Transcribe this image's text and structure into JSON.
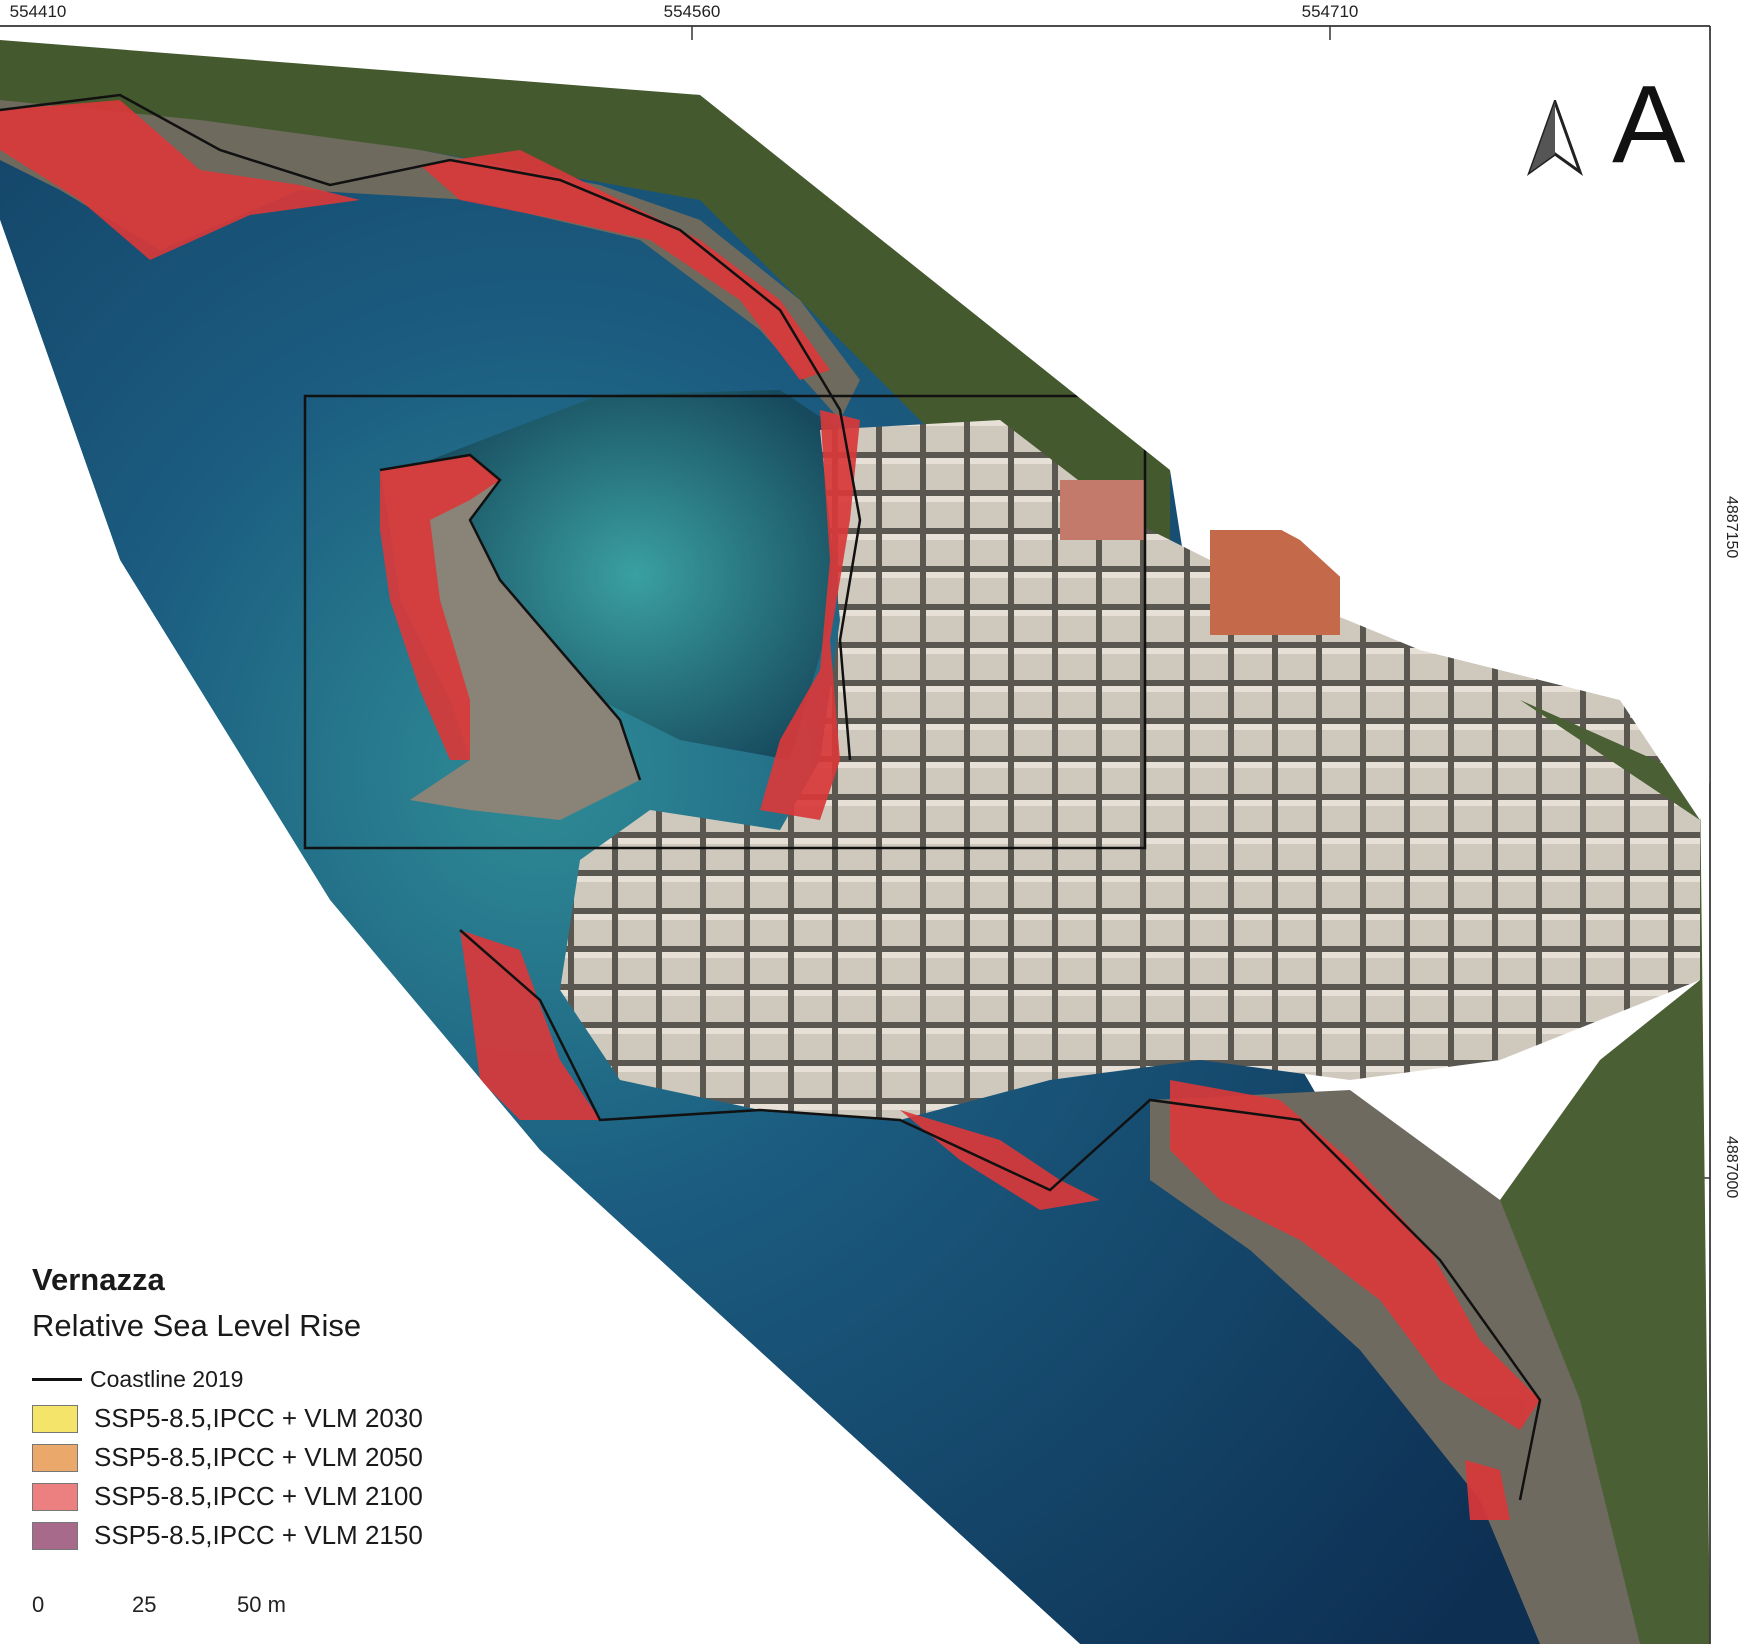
{
  "map": {
    "panel_letter": "A",
    "coords_top": [
      "554410",
      "554560",
      "554710"
    ],
    "coords_right": [
      "4887150",
      "4887000"
    ],
    "colors": {
      "sea_deep": "#0f3558",
      "sea_mid": "#1f6a8a",
      "sea_shallow": "#3a9aa0",
      "land": "#7a7a6a",
      "vegetation": "#3d5a2a",
      "roof": "#c8c0b4",
      "inundation": "#d9383a"
    }
  },
  "legend": {
    "place": "Vernazza",
    "subtitle": "Relative Sea Level Rise",
    "coastline": "Coastline 2019",
    "items": [
      {
        "label": "SSP5-8.5,IPCC + VLM 2030",
        "color": "#f5e46a"
      },
      {
        "label": "SSP5-8.5,IPCC + VLM 2050",
        "color": "#eaa86a"
      },
      {
        "label": "SSP5-8.5,IPCC + VLM 2100",
        "color": "#ec8080"
      },
      {
        "label": "SSP5-8.5,IPCC + VLM 2150",
        "color": "#a86a8a"
      }
    ]
  },
  "scale": {
    "ticks": [
      "0",
      "25",
      "50 m"
    ]
  }
}
